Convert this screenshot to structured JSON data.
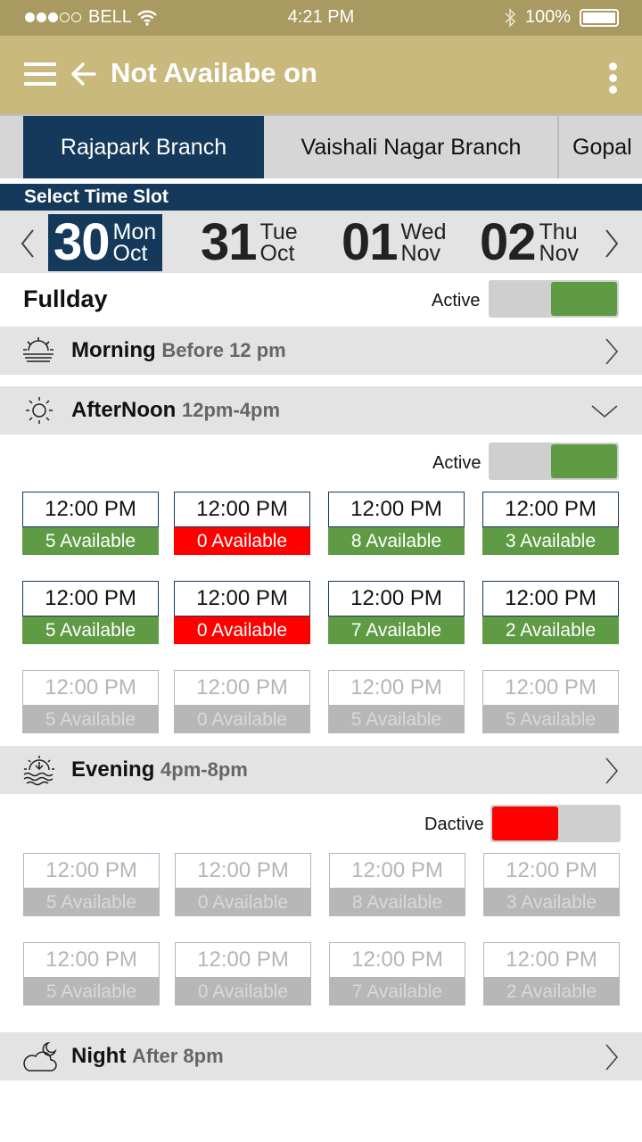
{
  "status_bar": {
    "carrier": "BELL",
    "time": "4:21 PM",
    "battery": "100%"
  },
  "app_bar": {
    "title": "Not Availabe on"
  },
  "branches": [
    {
      "label": "Rajapark Branch",
      "active": true
    },
    {
      "label": "Vaishali Nagar Branch",
      "active": false
    },
    {
      "label": "Gopal",
      "active": false
    }
  ],
  "slot_header": "Select Time Slot",
  "dates": [
    {
      "num": "30",
      "day": "Mon",
      "month": "Oct",
      "selected": true
    },
    {
      "num": "31",
      "day": "Tue",
      "month": "Oct",
      "selected": false
    },
    {
      "num": "01",
      "day": "Wed",
      "month": "Nov",
      "selected": false
    },
    {
      "num": "02",
      "day": "Thu",
      "month": "Nov",
      "selected": false
    }
  ],
  "fullday": {
    "label": "Fullday",
    "toggle_label": "Active",
    "on": true
  },
  "sections": {
    "morning": {
      "name": "Morning",
      "range": "Before 12 pm"
    },
    "afternoon": {
      "name": "AfterNoon",
      "range": "12pm-4pm",
      "toggle_label": "Active"
    },
    "evening": {
      "name": "Evening",
      "range": "4pm-8pm",
      "toggle_label": "Dactive"
    },
    "night": {
      "name": "Night",
      "range": "After 8pm"
    }
  },
  "afternoon_slots": [
    [
      {
        "time": "12:00 PM",
        "avail": "5 Available",
        "status": "green"
      },
      {
        "time": "12:00 PM",
        "avail": "0 Available",
        "status": "red"
      },
      {
        "time": "12:00 PM",
        "avail": "8 Available",
        "status": "green"
      },
      {
        "time": "12:00 PM",
        "avail": "3 Available",
        "status": "green"
      }
    ],
    [
      {
        "time": "12:00 PM",
        "avail": "5 Available",
        "status": "green"
      },
      {
        "time": "12:00 PM",
        "avail": "0 Available",
        "status": "red"
      },
      {
        "time": "12:00 PM",
        "avail": "7 Available",
        "status": "green"
      },
      {
        "time": "12:00 PM",
        "avail": "2 Available",
        "status": "green"
      }
    ],
    [
      {
        "time": "12:00 PM",
        "avail": "5 Available",
        "status": "disabled"
      },
      {
        "time": "12:00 PM",
        "avail": "0 Available",
        "status": "disabled"
      },
      {
        "time": "12:00 PM",
        "avail": "5 Available",
        "status": "disabled"
      },
      {
        "time": "12:00 PM",
        "avail": "5 Available",
        "status": "disabled"
      }
    ]
  ],
  "evening_slots": [
    [
      {
        "time": "12:00 PM",
        "avail": "5 Available",
        "status": "disabled"
      },
      {
        "time": "12:00 PM",
        "avail": "0 Available",
        "status": "disabled"
      },
      {
        "time": "12:00 PM",
        "avail": "8 Available",
        "status": "disabled"
      },
      {
        "time": "12:00 PM",
        "avail": "3 Available",
        "status": "disabled"
      }
    ],
    [
      {
        "time": "12:00 PM",
        "avail": "5 Available",
        "status": "disabled"
      },
      {
        "time": "12:00 PM",
        "avail": "0 Available",
        "status": "disabled"
      },
      {
        "time": "12:00 PM",
        "avail": "7 Available",
        "status": "disabled"
      },
      {
        "time": "12:00 PM",
        "avail": "2 Available",
        "status": "disabled"
      }
    ]
  ],
  "colors": {
    "primary": "#14395a",
    "gold": "#c9b97d",
    "green": "#5f9b45",
    "red": "#ff0000"
  },
  "icons": [
    "menu-icon",
    "back-arrow-icon",
    "more-vert-icon",
    "wifi-icon",
    "bluetooth-icon",
    "battery-icon",
    "sunrise-icon",
    "sun-icon",
    "sunset-icon",
    "moon-cloud-icon",
    "chevron-right-icon",
    "chevron-down-icon",
    "chevron-left-icon"
  ]
}
